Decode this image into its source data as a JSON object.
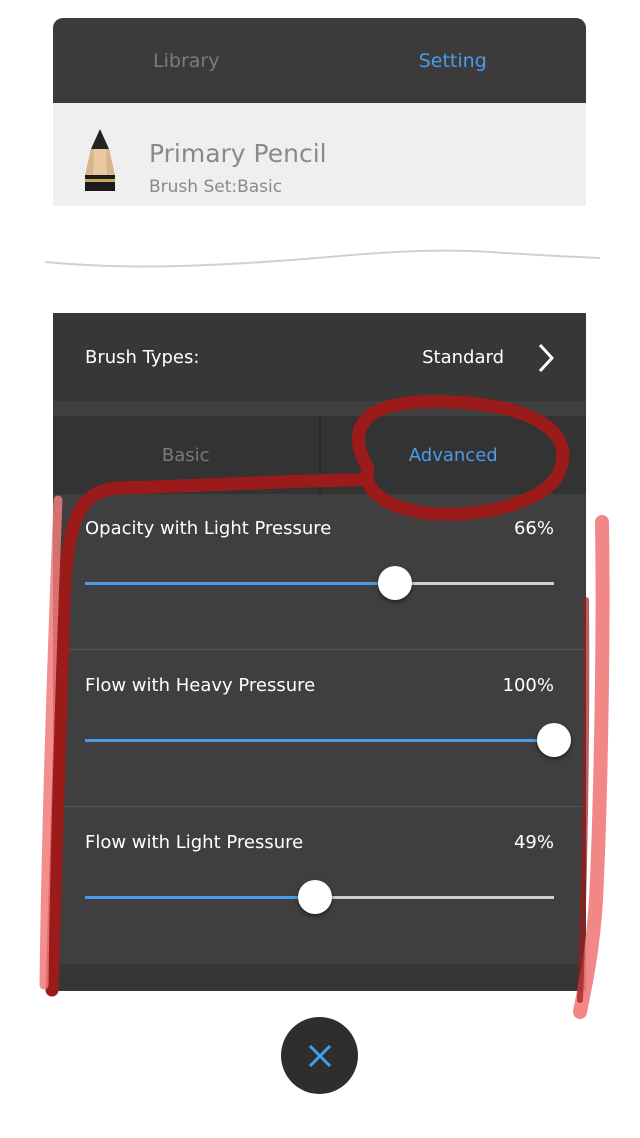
{
  "top_tabs": [
    {
      "label": "Library",
      "active": false
    },
    {
      "label": "Setting",
      "active": true
    }
  ],
  "brush": {
    "name": "Primary Pencil",
    "set": "Brush Set:Basic",
    "icon": "pencil-icon"
  },
  "brush_types": {
    "label": "Brush Types:",
    "value": "Standard",
    "icon": "chevron-right-icon"
  },
  "sub_tabs": [
    {
      "label": "Basic",
      "active": false
    },
    {
      "label": "Advanced",
      "active": true
    }
  ],
  "sliders": [
    {
      "label": "Opacity with Light Pressure",
      "value_text": "66%",
      "fraction": 0.66
    },
    {
      "label": "Flow with Heavy Pressure",
      "value_text": "100%",
      "fraction": 1.0
    },
    {
      "label": "Flow with Light Pressure",
      "value_text": "49%",
      "fraction": 0.49
    }
  ],
  "close": {
    "icon": "close-icon"
  },
  "colors": {
    "accent": "#4a9be8",
    "annotation_dark_red": "#9b1b1b",
    "annotation_light_red": "#f07a7a"
  }
}
